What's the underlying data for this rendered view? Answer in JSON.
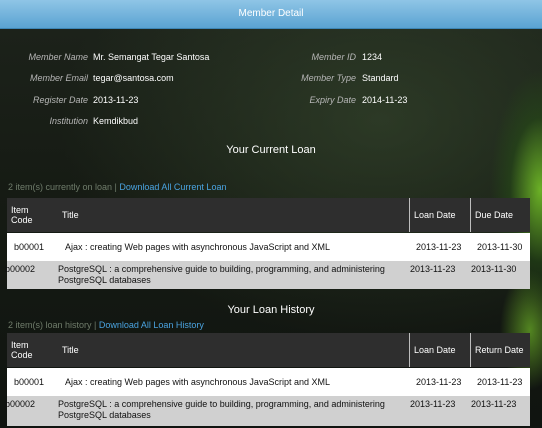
{
  "header": {
    "title": "Member Detail"
  },
  "member": {
    "name_label": "Member Name",
    "name": "Mr. Semangat Tegar Santosa",
    "email_label": "Member Email",
    "email": "tegar@santosa.com",
    "register_label": "Register Date",
    "register_date": "2013-11-23",
    "institution_label": "Institution",
    "institution": "Kemdikbud",
    "id_label": "Member ID",
    "id": "1234",
    "type_label": "Member Type",
    "type": "Standard",
    "expiry_label": "Expiry Date",
    "expiry_date": "2014-11-23"
  },
  "current_loan": {
    "title": "Your Current Loan",
    "count_text": "2 item(s) currently on loan | ",
    "download_link": "Download All Current Loan",
    "columns": [
      "Item Code",
      "Title",
      "Loan Date",
      "Due Date"
    ],
    "rows": [
      {
        "code": "b00001",
        "title": "Ajax : creating Web pages with asynchronous JavaScript and XML",
        "loan_date": "2013-11-23",
        "due_date": "2013-11-30"
      },
      {
        "code": "b00002",
        "title": "PostgreSQL : a comprehensive guide to building, programming, and administering PostgreSQL databases",
        "loan_date": "2013-11-23",
        "due_date": "2013-11-30"
      }
    ]
  },
  "loan_history": {
    "title": "Your Loan History",
    "count_text": "2 item(s) loan history | ",
    "download_link": "Download All Loan History",
    "columns": [
      "Item Code",
      "Title",
      "Loan Date",
      "Return Date"
    ],
    "rows": [
      {
        "code": "b00001",
        "title": "Ajax : creating Web pages with asynchronous JavaScript and XML",
        "loan_date": "2013-11-23",
        "return_date": "2013-11-23"
      },
      {
        "code": "b00002",
        "title": "PostgreSQL : a comprehensive guide to building, programming, and administering PostgreSQL databases",
        "loan_date": "2013-11-23",
        "return_date": "2013-11-23"
      }
    ]
  }
}
